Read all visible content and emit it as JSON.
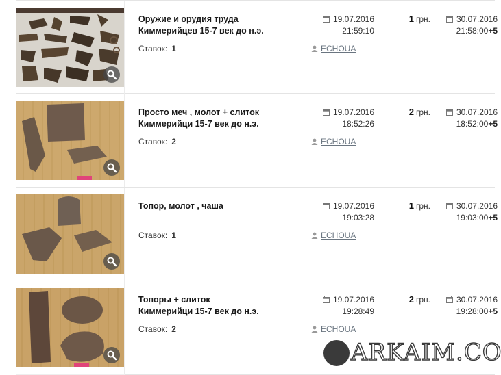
{
  "lots": [
    {
      "title_line1": "Оружие и орудия труда",
      "title_line2": "Киммерийцев 15-7 век до н.э.",
      "bids_label": "Ставок:",
      "bids": "1",
      "start_date": "19.07.2016",
      "start_time": "21:59:10",
      "seller": "ECHOUA",
      "price": "1",
      "currency": "грн.",
      "end_date": "30.07.2016",
      "end_time": "21:58:00",
      "tz": "+5"
    },
    {
      "title_line1": "Просто меч , молот + слиток",
      "title_line2": "Киммерийци 15-7 век до н.э.",
      "bids_label": "Ставок:",
      "bids": "2",
      "start_date": "19.07.2016",
      "start_time": "18:52:26",
      "seller": "ECHOUA",
      "price": "2",
      "currency": "грн.",
      "end_date": "30.07.2016",
      "end_time": "18:52:00",
      "tz": "+5"
    },
    {
      "title_line1": "Топор, молот , чаша",
      "title_line2": "",
      "bids_label": "Ставок:",
      "bids": "1",
      "start_date": "19.07.2016",
      "start_time": "19:03:28",
      "seller": "ECHOUA",
      "price": "1",
      "currency": "грн.",
      "end_date": "30.07.2016",
      "end_time": "19:03:00",
      "tz": "+5"
    },
    {
      "title_line1": "Топоры + слиток",
      "title_line2": "Киммерийци 15-7 век до н.э.",
      "bids_label": "Ставок:",
      "bids": "2",
      "start_date": "19.07.2016",
      "start_time": "19:28:49",
      "seller": "ECHOUA",
      "price": "2",
      "currency": "грн.",
      "end_date": "30.07.2016",
      "end_time": "19:28:00",
      "tz": "+5"
    }
  ],
  "icons": {
    "calendar": "calendar-icon",
    "person": "person-icon",
    "zoom": "magnifier-icon"
  },
  "colors": {
    "seller_link": "#6a7580",
    "thumb_bg": "#c9a46a",
    "zoom_badge": "#464646"
  },
  "watermark": {
    "text": "ARKAIM.CO"
  }
}
